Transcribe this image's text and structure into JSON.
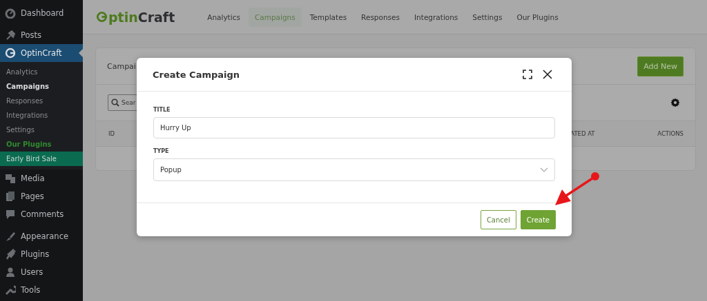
{
  "sidebar": {
    "groups": [
      [
        {
          "label": "Dashboard",
          "selected": false
        }
      ],
      [
        {
          "label": "Posts",
          "selected": false
        },
        {
          "label": "OptinCraft",
          "selected": true,
          "children": [
            {
              "label": "Analytics",
              "kind": "link",
              "selected": false
            },
            {
              "label": "Campaigns",
              "kind": "link",
              "selected": true
            },
            {
              "label": "Responses",
              "kind": "link",
              "selected": false
            },
            {
              "label": "Integrations",
              "kind": "link",
              "selected": false
            },
            {
              "label": "Settings",
              "kind": "link",
              "selected": false
            },
            {
              "label": "Our Plugins",
              "kind": "highlight",
              "selected": false
            },
            {
              "label": "Early Bird Sale",
              "kind": "promo",
              "selected": false
            }
          ]
        },
        {
          "label": "Media",
          "selected": false
        },
        {
          "label": "Pages",
          "selected": false
        },
        {
          "label": "Comments",
          "selected": false
        }
      ],
      [
        {
          "label": "Appearance",
          "selected": false
        },
        {
          "label": "Plugins",
          "selected": false
        },
        {
          "label": "Users",
          "selected": false
        },
        {
          "label": "Tools",
          "selected": false
        }
      ]
    ]
  },
  "header": {
    "logo": {
      "accent": "ptin",
      "rest": "Craft"
    },
    "tabs": [
      {
        "label": "Analytics",
        "selected": false
      },
      {
        "label": "Campaigns",
        "selected": true
      },
      {
        "label": "Templates",
        "selected": false
      },
      {
        "label": "Responses",
        "selected": false
      },
      {
        "label": "Integrations",
        "selected": false
      },
      {
        "label": "Settings",
        "selected": false
      },
      {
        "label": "Our Plugins",
        "selected": false
      }
    ]
  },
  "card": {
    "title": "Campai",
    "add_button": "Add New",
    "search": {
      "placeholder": "Sear"
    },
    "columns": [
      "ID",
      "ATED AT",
      "ACTIONS"
    ]
  },
  "modal": {
    "title": "Create Campaign",
    "fields": [
      {
        "kind": "text",
        "label": "TITLE",
        "value": "Hurry Up"
      },
      {
        "kind": "select",
        "label": "TYPE",
        "value": "Popup"
      }
    ],
    "buttons": [
      {
        "kind": "secondary",
        "label": "Cancel"
      },
      {
        "kind": "primary",
        "label": "Create"
      }
    ]
  }
}
